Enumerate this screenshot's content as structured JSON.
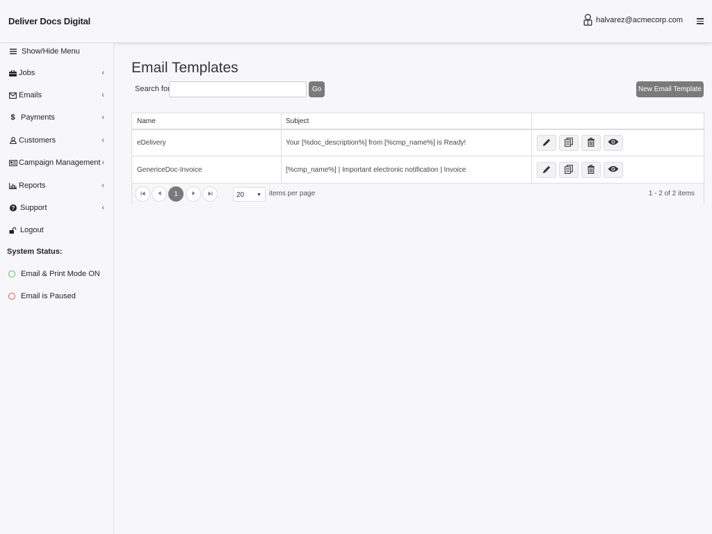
{
  "header": {
    "brand": "Deliver Docs Digital",
    "user_email": "halvarez@acmecorp.com"
  },
  "sidebar": {
    "items": [
      {
        "label": "Show/Hide Menu",
        "icon": "menu-icon",
        "has_chevron": false
      },
      {
        "label": "Jobs",
        "icon": "briefcase-icon",
        "has_chevron": true
      },
      {
        "label": "Emails",
        "icon": "envelope-icon",
        "has_chevron": true
      },
      {
        "label": "Payments",
        "icon": "dollar-icon",
        "has_chevron": true
      },
      {
        "label": "Customers",
        "icon": "user-icon",
        "has_chevron": true
      },
      {
        "label": "Campaign Management",
        "icon": "newspaper-icon",
        "has_chevron": true
      },
      {
        "label": "Reports",
        "icon": "bar-chart-icon",
        "has_chevron": true
      },
      {
        "label": "Support",
        "icon": "question-circle-icon",
        "has_chevron": true
      },
      {
        "label": "Logout",
        "icon": "unlock-icon",
        "has_chevron": false
      }
    ],
    "system_status_title": "System Status:",
    "status": [
      {
        "label": "Email & Print Mode ON",
        "color": "#5cb85c"
      },
      {
        "label": "Email is Paused",
        "color": "#d9534f"
      }
    ]
  },
  "main": {
    "title": "Email Templates",
    "search_label": "Search for:",
    "search_value": "",
    "go_label": "Go",
    "new_button_label": "New Email Template",
    "columns": [
      "Name",
      "Subject",
      ""
    ],
    "rows": [
      {
        "name": "eDelivery",
        "subject": "Your [%doc_description%] from [%cmp_name%] is Ready!"
      },
      {
        "name": "GenericeDoc-Invoice",
        "subject": "[%cmp_name%] | Important electronic notification | Invoice"
      }
    ],
    "pager": {
      "current_page": "1",
      "per_page": "20",
      "per_page_label": "items per page",
      "count_text": "1 - 2 of 2 items"
    }
  }
}
